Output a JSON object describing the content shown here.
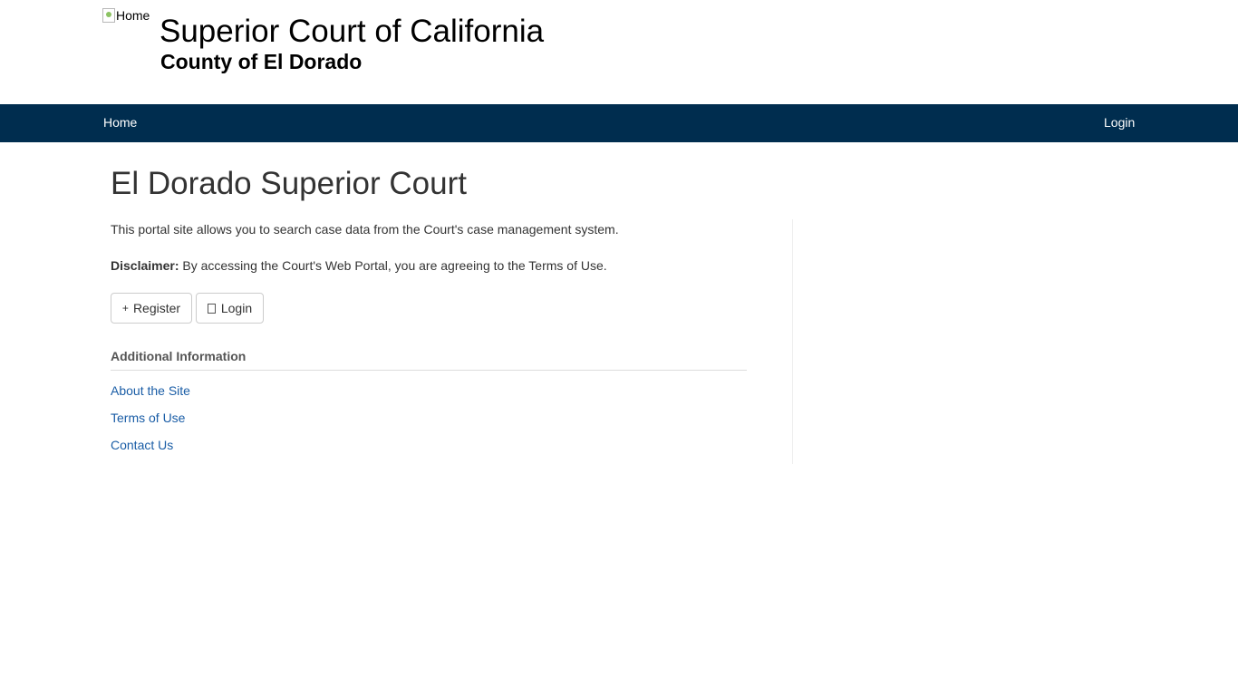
{
  "header": {
    "logo_alt": "Home",
    "title": "Superior Court of California",
    "subtitle": "County of El Dorado"
  },
  "navbar": {
    "home_label": "Home",
    "login_label": "Login",
    "background_color": "#002d4f"
  },
  "main": {
    "page_title": "El Dorado Superior Court",
    "intro_text": "This portal site allows you to search case data from the Court's case management system.",
    "disclaimer_label": "Disclaimer:",
    "disclaimer_text": "By accessing the Court's Web Portal, you are agreeing to the Terms of Use.",
    "buttons": {
      "register_icon": "plus-icon",
      "register_label": "Register",
      "login_icon": "login-icon",
      "login_label": "Login"
    },
    "additional_info": {
      "heading": "Additional Information",
      "links": [
        "About the Site",
        "Terms of Use",
        "Contact Us"
      ],
      "link_color": "#1a5da6"
    }
  }
}
